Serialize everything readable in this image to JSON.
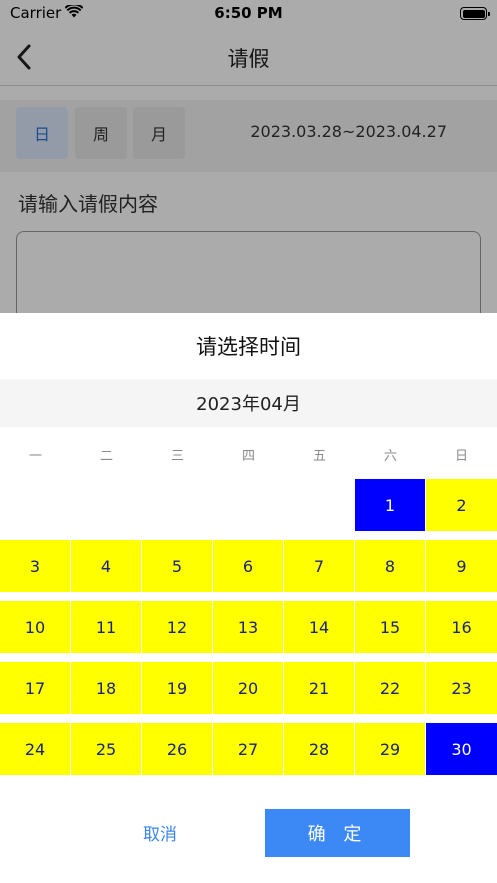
{
  "status_bar": {
    "carrier": "Carrier",
    "time": "6:50 PM"
  },
  "nav": {
    "title": "请假"
  },
  "segments": [
    {
      "label": "日",
      "active": true
    },
    {
      "label": "周",
      "active": false
    },
    {
      "label": "月",
      "active": false
    }
  ],
  "date_range": "2023.03.28~2023.04.27",
  "content_label": "请输入请假内容",
  "sheet": {
    "title": "请选择时间",
    "month": "2023年04月",
    "weekdays": [
      "一",
      "二",
      "三",
      "四",
      "五",
      "六",
      "日"
    ],
    "days": [
      "1",
      "2",
      "3",
      "4",
      "5",
      "6",
      "7",
      "8",
      "9",
      "10",
      "11",
      "12",
      "13",
      "14",
      "15",
      "16",
      "17",
      "18",
      "19",
      "20",
      "21",
      "22",
      "23",
      "24",
      "25",
      "26",
      "27",
      "28",
      "29",
      "30"
    ],
    "first_weekday_index": 5,
    "selected_days": [
      "1",
      "30"
    ],
    "cancel_label": "取消",
    "confirm_label": "确 定"
  },
  "colors": {
    "range_fill": "#ffff00",
    "selected_fill": "#0000ff",
    "day_text": "#1a237e",
    "accent": "#3c88f5",
    "cancel_text": "#3a86e8"
  },
  "icons": {
    "back": "chevron-left-icon",
    "wifi": "wifi-icon",
    "battery": "battery-icon"
  }
}
